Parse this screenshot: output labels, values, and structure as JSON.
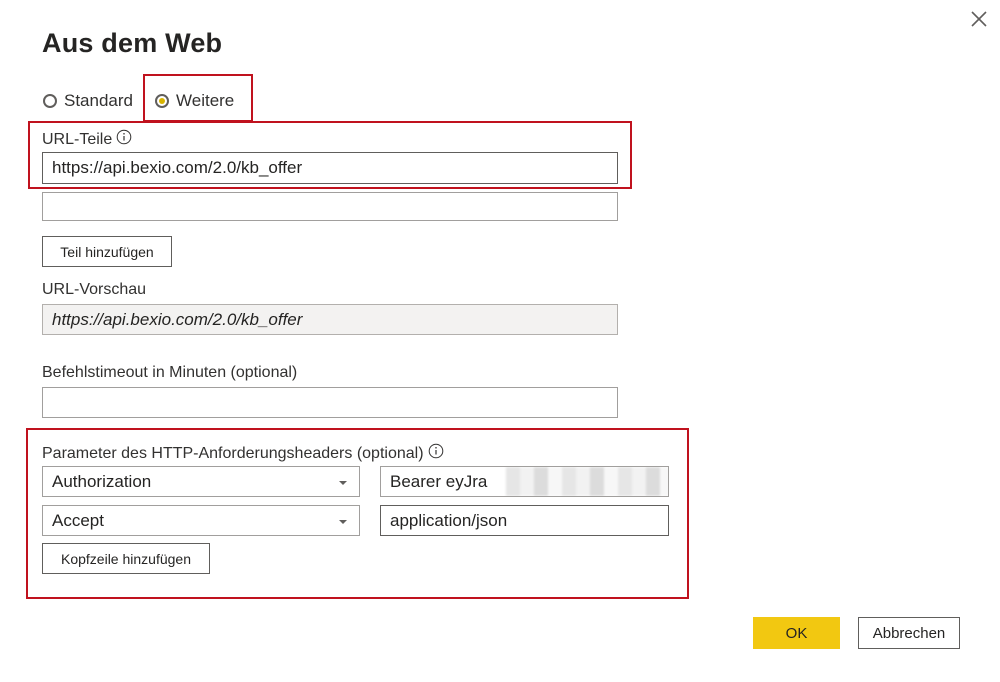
{
  "dialog": {
    "title": "Aus dem Web",
    "close_icon": "close-icon"
  },
  "mode": {
    "options": [
      {
        "label": "Standard",
        "selected": false
      },
      {
        "label": "Weitere",
        "selected": true
      }
    ]
  },
  "url_parts": {
    "label": "URL-Teile",
    "info_icon": "info-icon",
    "part1_value": "https://api.bexio.com/2.0/kb_offer",
    "part2_value": "",
    "add_part_label": "Teil hinzufügen"
  },
  "url_preview": {
    "label": "URL-Vorschau",
    "value": "https://api.bexio.com/2.0/kb_offer"
  },
  "timeout": {
    "label": "Befehlstimeout in Minuten (optional)",
    "value": ""
  },
  "headers": {
    "label": "Parameter des HTTP-Anforderungsheaders (optional)",
    "info_icon": "info-icon",
    "rows": [
      {
        "name": "Authorization",
        "value": "Bearer eyJra"
      },
      {
        "name": "Accept",
        "value": "application/json"
      }
    ],
    "add_header_label": "Kopfzeile hinzufügen"
  },
  "footer": {
    "ok_label": "OK",
    "cancel_label": "Abbrechen"
  },
  "colors": {
    "accent": "#f2c811",
    "highlight_box": "#c0121e",
    "radio_dot": "#d8b400"
  }
}
